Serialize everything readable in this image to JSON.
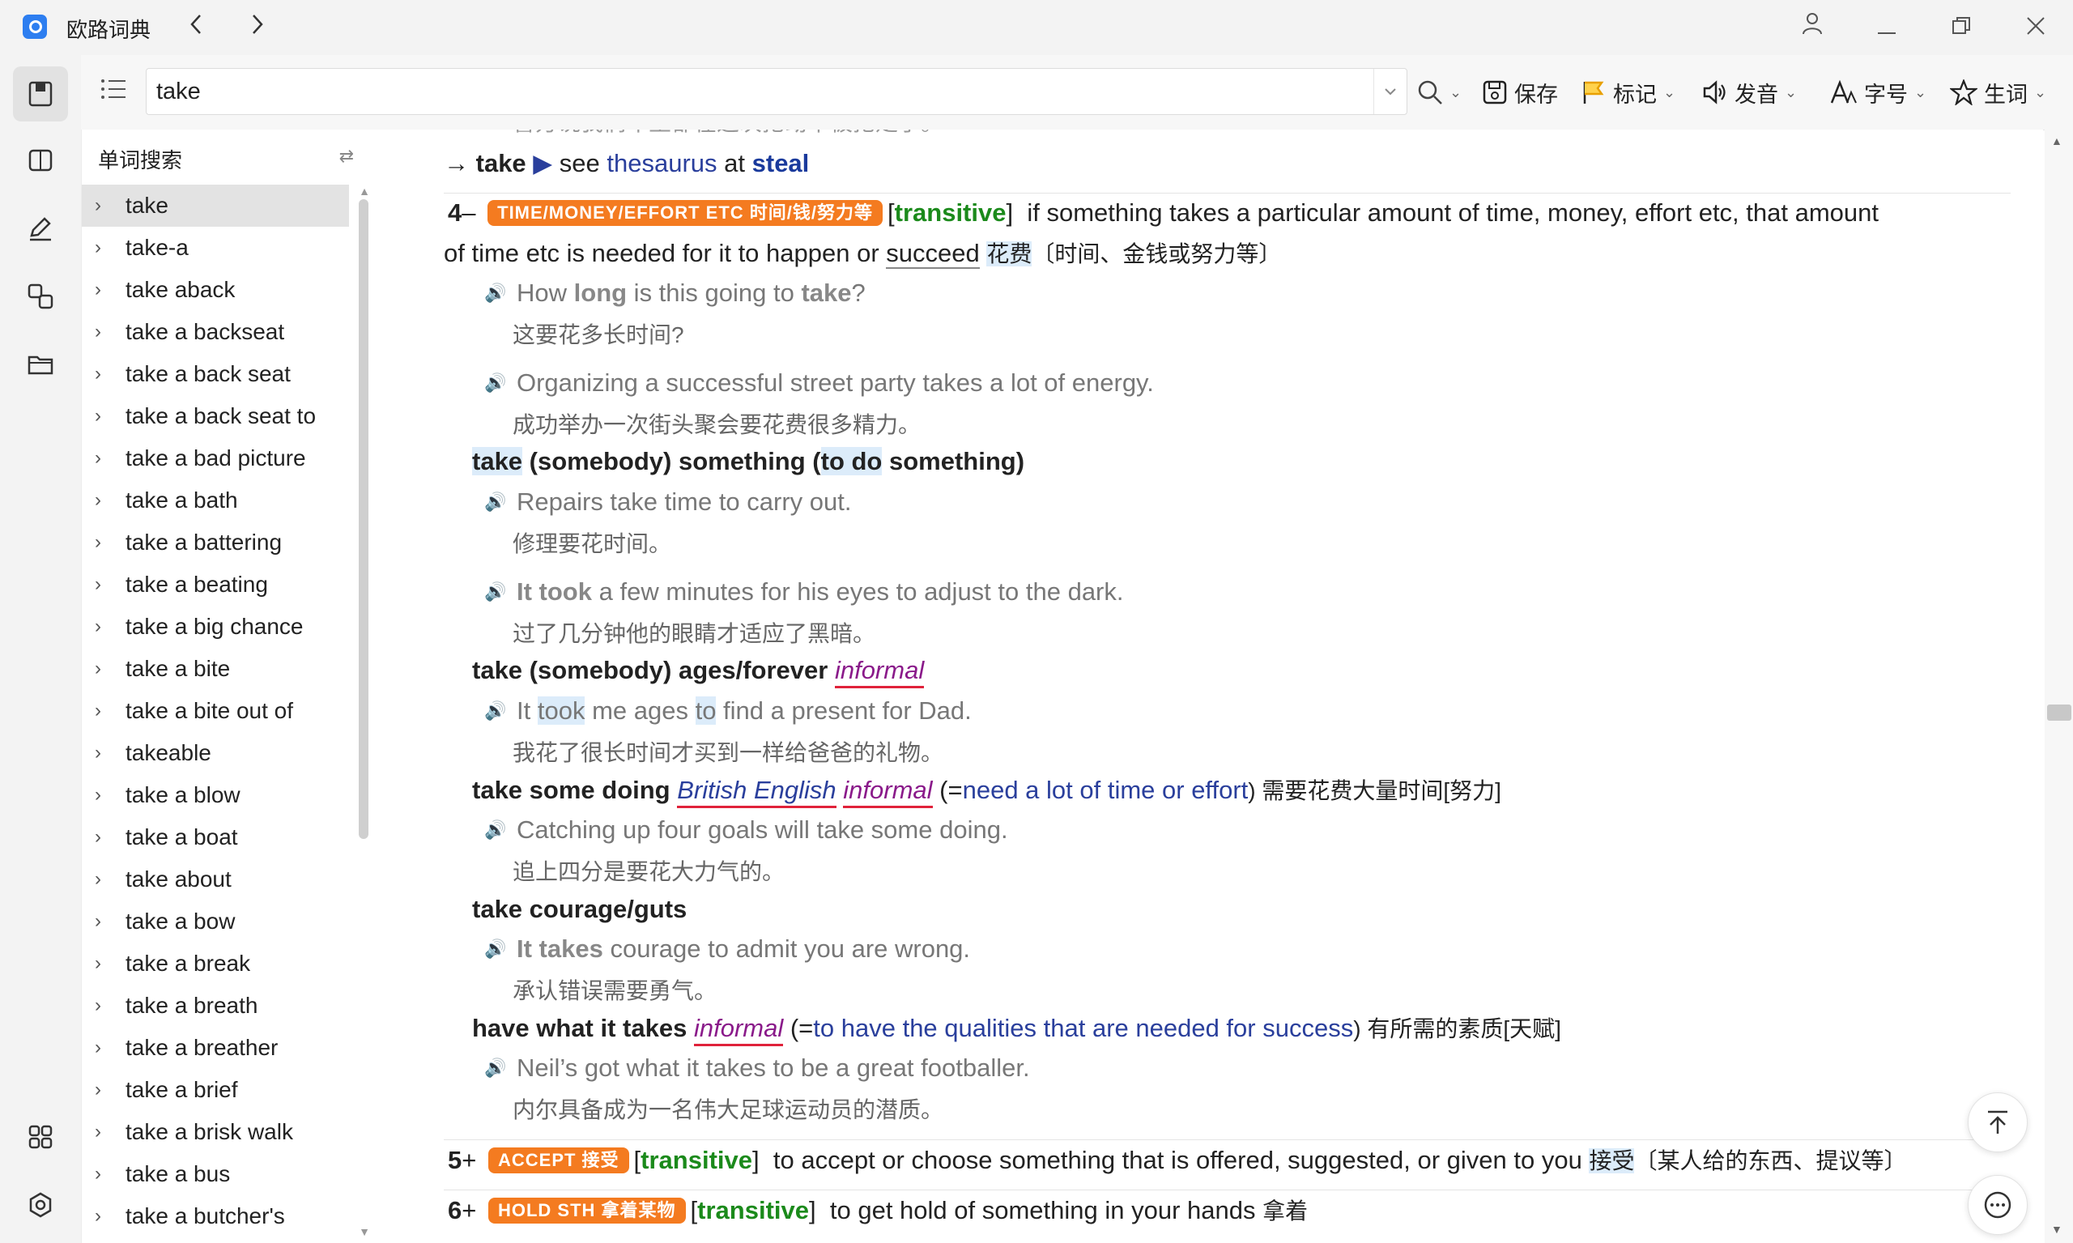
{
  "window": {
    "app_title": "欧路词典",
    "back_icon": "chevron-left-icon",
    "forward_icon": "chevron-right-icon",
    "controls": [
      "user-icon",
      "minimize-icon",
      "restore-icon",
      "close-icon"
    ]
  },
  "rail": {
    "icons": [
      "dictionary-icon",
      "book-icon",
      "edit-icon",
      "translate-icon",
      "folder-icon"
    ],
    "bottom_icons": [
      "apps-icon",
      "settings-icon"
    ]
  },
  "toolbar": {
    "search_value": "take",
    "save_label": "保存",
    "mark_label": "标记",
    "pronounce_label": "发音",
    "font_label": "字号",
    "vocab_label": "生词"
  },
  "wordlist": {
    "header": "单词搜索",
    "items": [
      "take",
      "take-a",
      "take aback",
      "take a backseat",
      "take a back seat",
      "take a back seat to",
      "take a bad picture",
      "take a bath",
      "take a battering",
      "take a beating",
      "take a big chance",
      "take a bite",
      "take a bite out of",
      "takeable",
      "take a blow",
      "take a boat",
      "take about",
      "take a bow",
      "take a break",
      "take a breath",
      "take a breather",
      "take a brief",
      "take a brisk walk",
      "take a bus",
      "take a butcher's"
    ]
  },
  "entry": {
    "cut_line": "警方说我们车主都在这次抢劫中被抢走了。",
    "xref": {
      "arrow": "→",
      "head": "take",
      "marker": "▶",
      "see": "see",
      "thesaurus": "thesaurus",
      "at": "at",
      "target": "steal"
    },
    "sense4": {
      "num": "4",
      "toggle": "–",
      "badge": "TIME/MONEY/EFFORT ETC 时间/钱/努力等",
      "gram": "transitive",
      "def_line1": "if something takes a particular amount of time, money, effort etc, that amount",
      "def_line2_a": "of time etc is needed for it to happen or ",
      "def_succeed": "succeed",
      "def_zh_hl": "花费",
      "def_zh_rest": "〔时间、金钱或努力等〕",
      "ex1_a": "How ",
      "ex1_b": "long",
      "ex1_c": " is this going to ",
      "ex1_d": "take",
      "ex1_e": "?",
      "ex1_zh": "这要花多长时间?",
      "ex2": "Organizing a successful street party takes a lot of energy.",
      "ex2_zh": "成功举办一次街头聚会要花费很多精力。",
      "pattern1_a": "take",
      "pattern1_b": " (somebody) something (",
      "pattern1_c": "to do",
      "pattern1_d": " something)",
      "ex3": "Repairs take time to carry out.",
      "ex3_zh": "修理要花时间。",
      "ex4_a": "It took",
      "ex4_b": " a few minutes for his eyes to adjust to the dark.",
      "ex4_zh": "过了几分钟他的眼睛才适应了黑暗。",
      "phrase1": "take (somebody) ages/forever",
      "phrase1_reg": "informal",
      "ex5_a": "It ",
      "ex5_b": "took",
      "ex5_c": " me ages ",
      "ex5_d": "to",
      "ex5_e": " find a present for Dad.",
      "ex5_zh": "我花了很长时间才买到一样给爸爸的礼物。",
      "phrase2": "take some doing",
      "phrase2_reg1": "British English",
      "phrase2_reg2": "informal",
      "phrase2_open": " (=",
      "phrase2_def": "need a lot of time or effort",
      "phrase2_zh": ") 需要花费大量时间[努力]",
      "ex6": "Catching up four goals will take some doing.",
      "ex6_zh": "追上四分是要花大力气的。",
      "phrase3": "take courage/guts",
      "ex7_a": "It takes",
      "ex7_b": " courage to admit you are wrong.",
      "ex7_zh": "承认错误需要勇气。",
      "phrase4": "have what it takes",
      "phrase4_reg": "informal",
      "phrase4_open": " (=",
      "phrase4_def": "to have the qualities that are needed for success",
      "phrase4_zh": ") 有所需的素质[天赋]",
      "ex8": "Neil’s got what it takes to be a great footballer.",
      "ex8_zh": "内尔具备成为一名伟大足球运动员的潜质。"
    },
    "sense5": {
      "num": "5",
      "toggle": "+",
      "badge": "ACCEPT 接受",
      "gram": "transitive",
      "def": "to accept or choose something that is offered, suggested, or given to you",
      "zh_hl": "接受",
      "zh_rest": "〔某人给的东西、提议等〕"
    },
    "sense6": {
      "num": "6",
      "toggle": "+",
      "badge": "HOLD STH 拿着某物",
      "gram": "transitive",
      "def": "to get hold of something in your hands",
      "zh": "拿着"
    }
  },
  "colors": {
    "badge": "#f47b20",
    "grammar": "#1b8a1b",
    "link": "#2a3f9c",
    "register": "#8a1a8a",
    "underline": "#e0223a",
    "highlight": "#dcecfa"
  }
}
